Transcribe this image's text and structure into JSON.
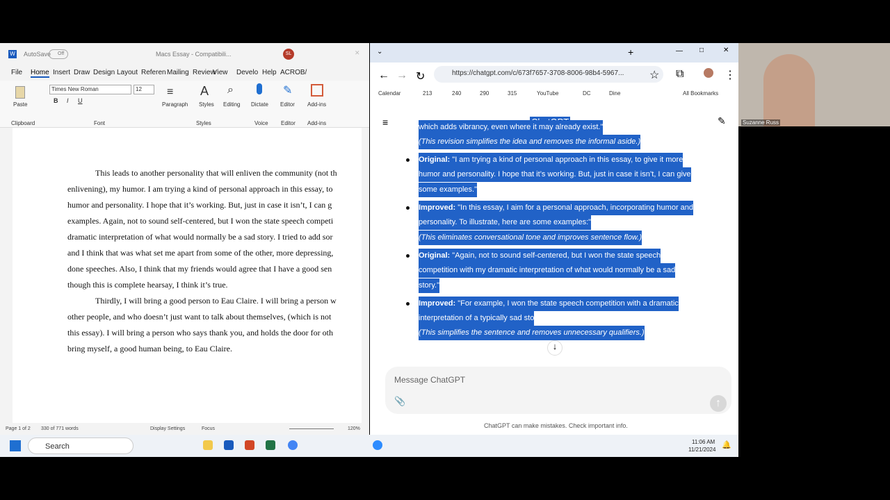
{
  "word": {
    "autosave": "AutoSave",
    "autosave_state": "Off",
    "doc_title": "Macs Essay - Compatibili...",
    "user_initials": "SL",
    "menus": [
      "File",
      "Home",
      "Insert",
      "Draw",
      "Design",
      "Layout",
      "Referen",
      "Mailing",
      "Review",
      "View",
      "Develo",
      "Help",
      "ACROB/"
    ],
    "font_name": "Times New Roman",
    "font_size": "12",
    "groups": {
      "clipboard": "Clipboard",
      "font": "Font",
      "styles": "Styles",
      "voice": "Voice",
      "editor": "Editor",
      "addins": "Add-ins"
    },
    "buttons": {
      "paste": "Paste",
      "paragraph": "Paragraph",
      "styles": "Styles",
      "editing": "Editing",
      "dictate": "Dictate",
      "editor": "Editor",
      "addins": "Add-ins"
    },
    "doc_lines": [
      "This leads to another personality that will enliven the community (not th",
      "enlivening), my humor. I am trying a kind of personal approach in this essay, to",
      "humor and personality. I hope that it’s working. But, just in case it isn’t, I can g",
      "examples. Again, not to sound self-centered, but I won the state speech competi",
      "dramatic interpretation of what would normally be a sad story. I tried to add sor",
      "and I think that was what set me apart from some of the other, more depressing,",
      "done speeches. Also, I think that my friends would agree that I have a good sen",
      "though this is complete hearsay, I think it’s true.",
      "Thirdly, I will bring a good person to Eau Claire. I will bring a person w",
      "other people, and who doesn’t just want to talk about themselves, (which is not",
      "this essay). I will bring a person who says thank you, and holds the door for oth",
      "bring myself, a good human being, to Eau Claire."
    ],
    "status": {
      "page": "Page 1 of 2",
      "words": "330 of 771 words",
      "display": "Display Settings",
      "focus": "Focus",
      "zoom": "120%"
    }
  },
  "chrome": {
    "url": "https://chatgpt.com/c/673f7657-3708-8006-98b4-5967...",
    "bookmarks": [
      "Calendar",
      "213",
      "240",
      "290",
      "315",
      "YouTube",
      "DC",
      "Dine"
    ],
    "all_bookmarks": "All Bookmarks",
    "app_title": "ChatGPT",
    "lines": [
      {
        "text": "which adds vibrancy, even where it may already exist.\"",
        "italic": false
      },
      {
        "text": "(This revision simplifies the idea and removes the informal aside.)",
        "italic": true
      },
      {
        "label": "Original:",
        "text": " \"I am trying a kind of personal approach in this essay, to give it more",
        "bullet": true
      },
      {
        "text": "humor and personality. I hope that it’s working. But, just in case it isn’t, I can give"
      },
      {
        "text": "some examples.\""
      },
      {
        "label": "Improved:",
        "text": " \"In this essay, I aim for a personal approach, incorporating humor and",
        "bullet": true
      },
      {
        "text": "personality. To illustrate, here are some examples:\""
      },
      {
        "text": "(This eliminates conversational tone and improves sentence flow.)",
        "italic": true
      },
      {
        "label": "Original:",
        "text": " \"Again, not to sound self-centered, but I won the state speech",
        "bullet": true
      },
      {
        "text": "competition with my dramatic interpretation of what would normally be a sad"
      },
      {
        "text": "story.\""
      },
      {
        "label": "Improved:",
        "text": " \"For example, I won the state speech competition with a dramatic",
        "bullet": true
      },
      {
        "text": "interpretation of a typically sad sto"
      },
      {
        "text": "(This simplifies the sentence and removes unnecessary qualifiers.)",
        "italic": true
      }
    ],
    "message_placeholder": "Message ChatGPT",
    "disclaimer": "ChatGPT can make mistakes. Check important info."
  },
  "taskbar": {
    "search": "Search",
    "time": "11:06 AM",
    "date": "11/21/2024"
  },
  "video": {
    "name": "Suzanne Russ"
  }
}
